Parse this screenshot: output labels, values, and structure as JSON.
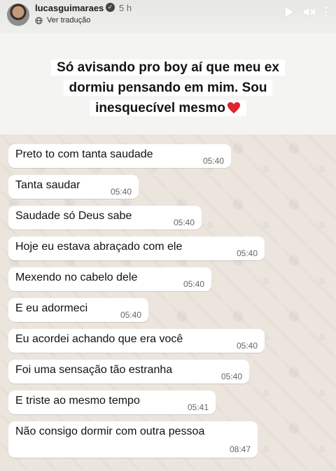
{
  "header": {
    "username": "lucasguimaraes",
    "time_ago": "5 h",
    "translate_label": "Ver tradução",
    "icons": [
      "avatar",
      "verified-badge-icon",
      "globe-icon",
      "play-icon",
      "mute-icon",
      "more-icon"
    ]
  },
  "caption": {
    "lines": [
      "Só avisando pro boy aí que meu ex",
      "dormiu pensando em mim. Sou",
      "inesquecível mesmo"
    ],
    "emoji": "heart-icon"
  },
  "chat": {
    "messages": [
      {
        "text": "Preto to com tanta saudade",
        "time": "05:40"
      },
      {
        "text": "Tanta saudar",
        "time": "05:40"
      },
      {
        "text": "Saudade só Deus sabe",
        "time": "05:40"
      },
      {
        "text": "Hoje eu estava abraçado com ele",
        "time": "05:40"
      },
      {
        "text": "Mexendo no cabelo dele",
        "time": "05:40"
      },
      {
        "text": "E eu adormeci",
        "time": "05:40"
      },
      {
        "text": "Eu acordei achando que era você",
        "time": "05:40"
      },
      {
        "text": "Foi uma sensação tão estranha",
        "time": "05:40"
      },
      {
        "text": "E triste ao mesmo tempo",
        "time": "05:41"
      },
      {
        "text": "Não consigo dormir com outra pessoa",
        "time": "08:47"
      }
    ]
  },
  "colors": {
    "bubble": "#ffffff",
    "chat_background": "#ece5dd",
    "heart": "#e0242f"
  }
}
